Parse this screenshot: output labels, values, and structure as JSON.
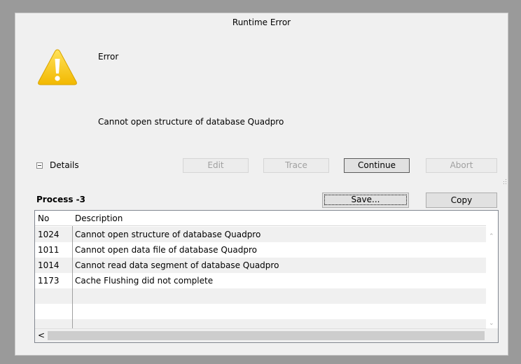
{
  "window": {
    "title": "Runtime Error"
  },
  "dialog": {
    "heading": "Error",
    "message": "Cannot open structure of database Quadpro",
    "icon": "warning-icon",
    "accent_color": "#f7c600"
  },
  "details": {
    "label": "Details",
    "expanded": true
  },
  "buttons": {
    "edit": "Edit",
    "trace": "Trace",
    "continue": "Continue",
    "abort": "Abort",
    "save": "Save...",
    "copy": "Copy"
  },
  "process": {
    "label": "Process -3"
  },
  "table": {
    "headers": {
      "no": "No",
      "description": "Description"
    },
    "rows": [
      {
        "no": "1024",
        "description": "Cannot open structure of database Quadpro"
      },
      {
        "no": "1011",
        "description": "Cannot open data file of database Quadpro"
      },
      {
        "no": "1014",
        "description": "Cannot read data segment of database Quadpro"
      },
      {
        "no": "1173",
        "description": "Cache Flushing did not complete"
      }
    ]
  },
  "scrollbar": {
    "left": "<",
    "right": ">",
    "up": "^",
    "down": "v"
  }
}
